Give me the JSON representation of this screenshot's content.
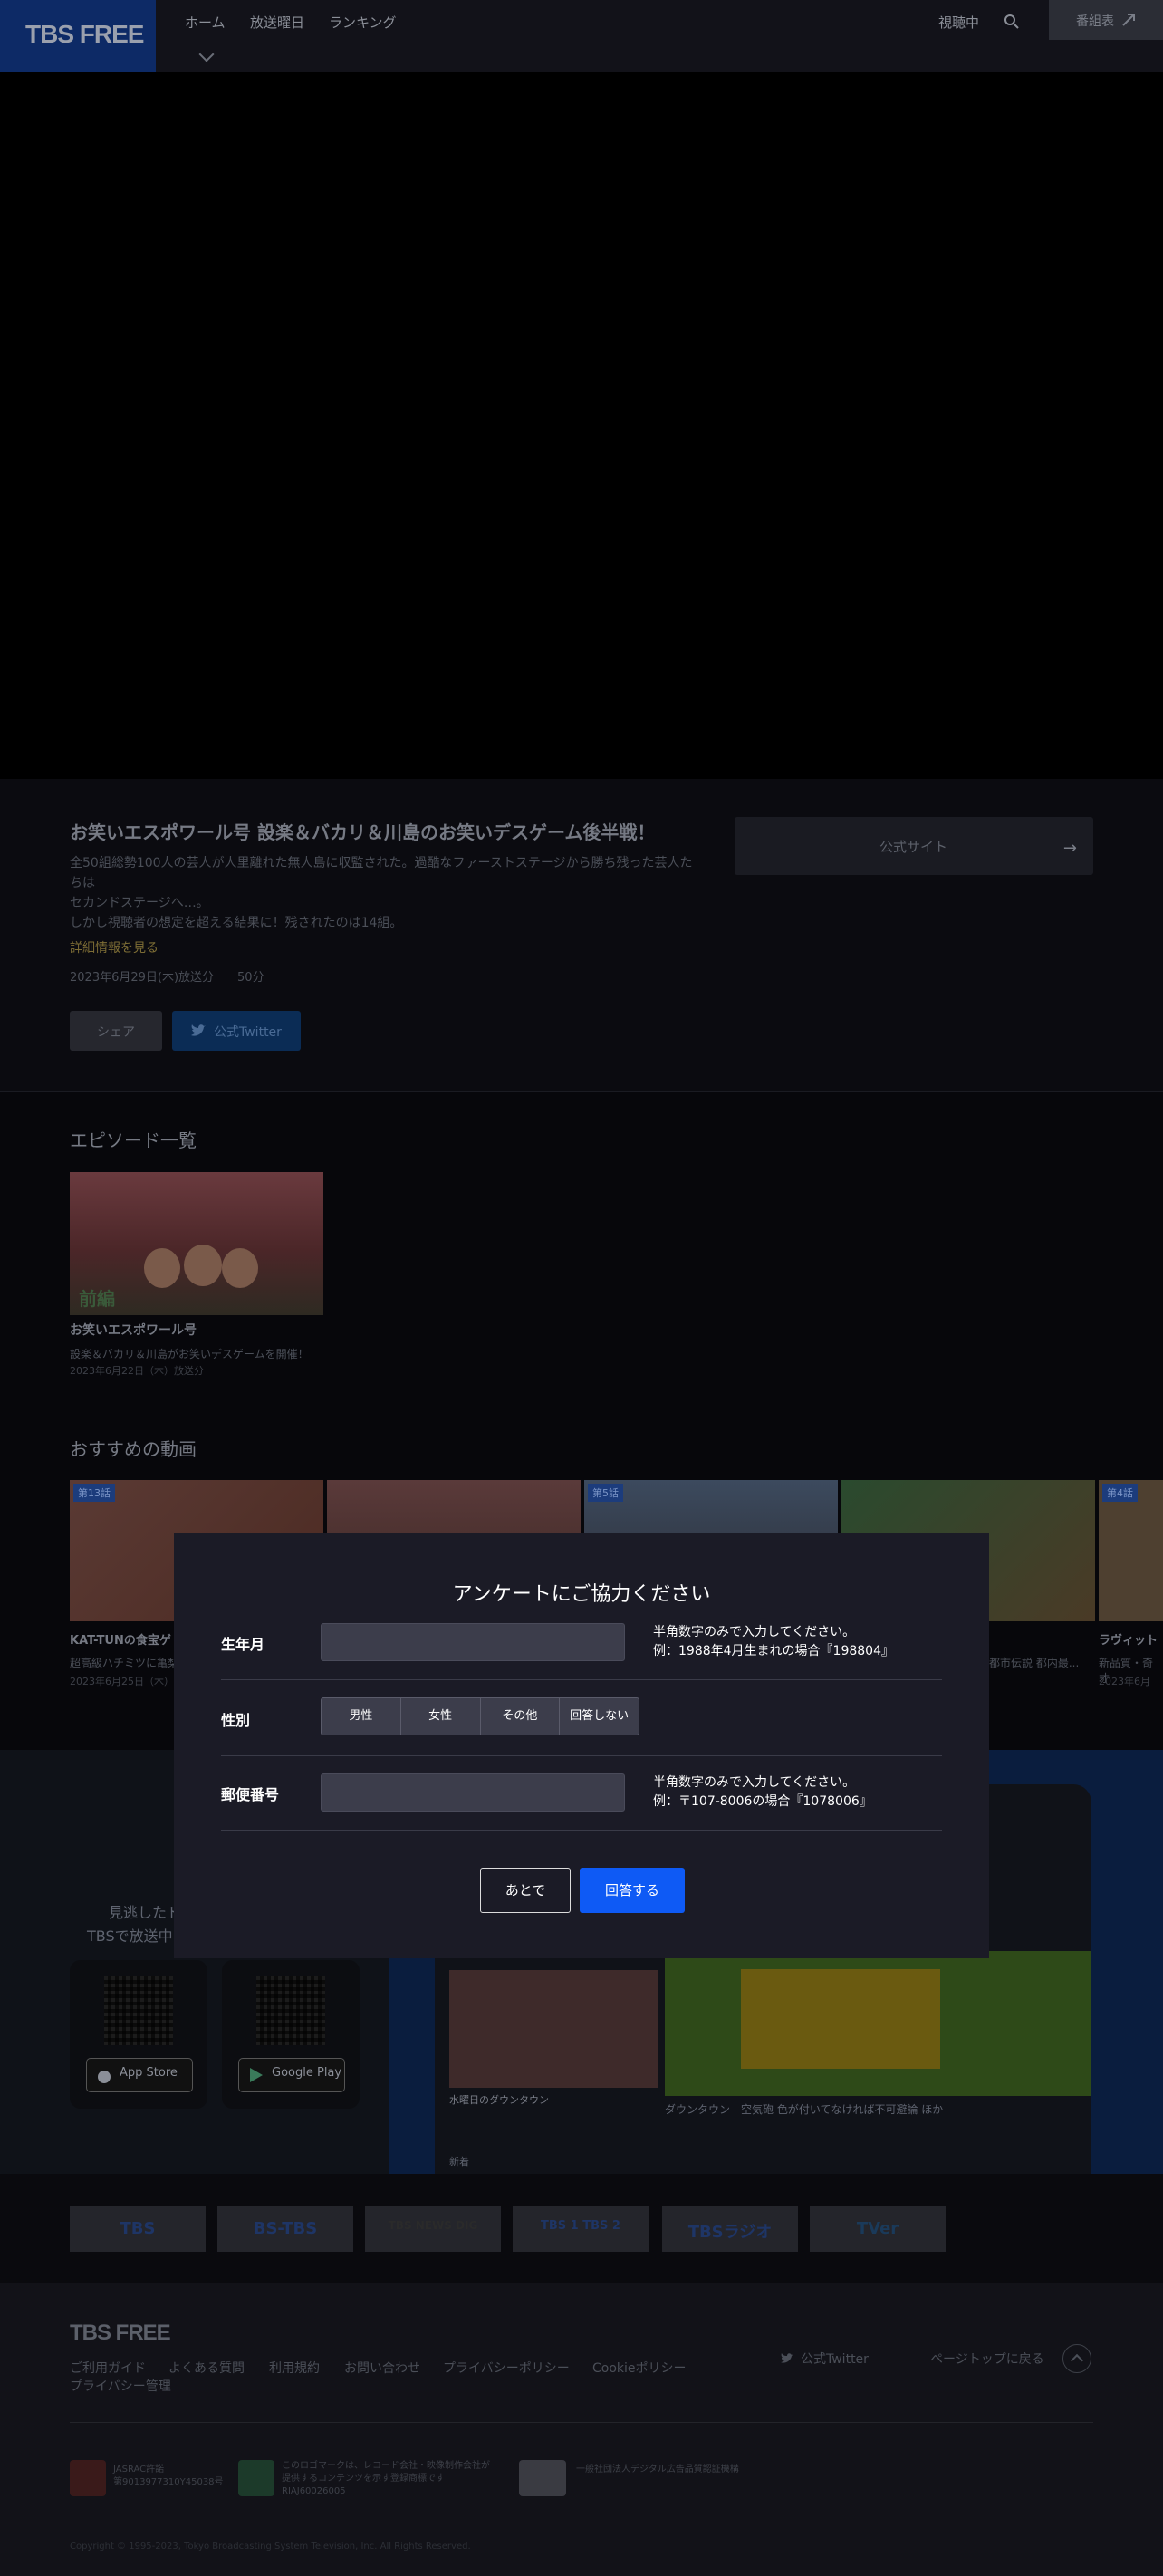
{
  "header": {
    "logo": "TBS FREE",
    "nav": [
      "ホーム",
      "放送曜日",
      "ランキング"
    ],
    "watching": "視聴中",
    "library": "番組表"
  },
  "program": {
    "title": "お笑いエスポワール号 設楽＆バカリ＆川島のお笑いデスゲーム後半戦！",
    "description_line1": "全50組総勢100人の芸人が人里離れた無人島に収監された。過酷なファーストステージから勝ち残った芸人たちは",
    "description_line2": "セカンドステージへ…。",
    "description_line3": "しかし視聴者の想定を超える結果に！残されたのは14組。",
    "more_link": "詳細情報を見る",
    "meta": "2023年6月29日(木)放送分　　50分",
    "share": "シェア",
    "twitter": "公式Twitter",
    "official_site": "公式サイト"
  },
  "episodes": {
    "heading": "エピソード一覧",
    "items": [
      {
        "title": "お笑いエスポワール号",
        "subtitle": "設楽＆バカリ＆川島がお笑いデスゲームを開催！",
        "date": "2023年6月22日（木）放送分",
        "thumb_label_left": "前編"
      }
    ]
  },
  "recommended": {
    "heading": "おすすめの動画",
    "items": [
      {
        "badge": "第13話",
        "title": "KAT-TUNの食宝ゲ",
        "subtitle": "超高級ハチミツに亀梨",
        "date": "2023年6月25日（木）"
      },
      {
        "badge": "",
        "title": "",
        "subtitle": "",
        "date": ""
      },
      {
        "badge": "第5話",
        "title": "",
        "subtitle": "",
        "date": ""
      },
      {
        "badge": "",
        "title": "",
        "subtitle": "都市伝説 都内最...",
        "date": ""
      },
      {
        "badge": "第4話",
        "title": "ラヴィット",
        "subtitle": "新品質・奇才",
        "date": "2023年6月"
      }
    ]
  },
  "app_promo": {
    "line1": "見逃したド",
    "line2": "TBSで放送中の",
    "app_store": "App Store",
    "google_play": "Google Play",
    "tile_title": "水曜日のダウンタウン",
    "banner_caption": "ダウンタウン　空気砲 色が付いてなければ不可避論 ほか",
    "tab_label": "新着"
  },
  "partner_logos": [
    "TBS",
    "BS-TBS",
    "TBS NEWS DIG",
    "TBS 1 TBS 2",
    "TBSラジオ",
    "TVer"
  ],
  "footer": {
    "logo": "TBS FREE",
    "links": [
      "ご利用ガイド",
      "よくある質問",
      "利用規約",
      "お問い合わせ",
      "プライバシーポリシー",
      "Cookieポリシー"
    ],
    "links2": [
      "プライバシー管理"
    ],
    "twitter": "公式Twitter",
    "page_top": "ページトップに戻る",
    "badge1_text": "JASRAC許諾\n第9013977310Y45038号",
    "badge2_text": "このロゴマークは、レコード会社・映像制作会社が\n提供するコンテンツを示す登録商標です\nRIAJ60026005",
    "badge3_text": "一般社団法人デジタル広告品質認証機構",
    "copyright": "Copyright © 1995-2023, Tokyo Broadcasting System Television, Inc. All Rights Reserved."
  },
  "survey": {
    "title": "アンケートにご協力ください",
    "birth_label": "生年月",
    "birth_value": "",
    "birth_help1": "半角数字のみで入力してください。",
    "birth_help2": "例：1988年4月生まれの場合『198804』",
    "gender_label": "性別",
    "gender_options": [
      "男性",
      "女性",
      "その他",
      "回答しない"
    ],
    "zip_label": "郵便番号",
    "zip_value": "",
    "zip_help1": "半角数字のみで入力してください。",
    "zip_help2": "例：〒107-8006の場合『1078006』",
    "later": "あとで",
    "answer": "回答する"
  }
}
